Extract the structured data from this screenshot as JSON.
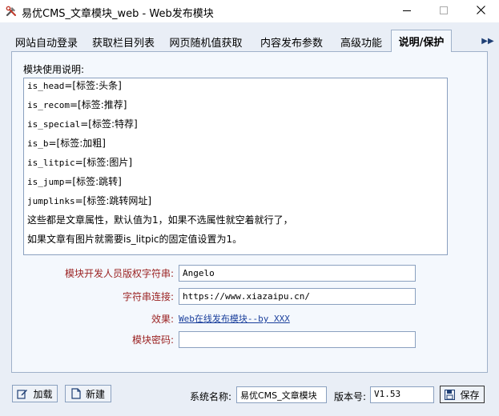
{
  "window": {
    "title": "易优CMS_文章模块_web - Web发布模块",
    "icon": "tools-icon"
  },
  "tabs": [
    {
      "label": "网站自动登录",
      "active": false
    },
    {
      "label": "获取栏目列表",
      "active": false
    },
    {
      "label": "网页随机值获取",
      "active": false
    },
    {
      "label": "内容发布参数",
      "active": false
    },
    {
      "label": "高级功能",
      "active": false
    },
    {
      "label": "说明/保护",
      "active": true
    }
  ],
  "tab_scroll_glyph": "▶▶",
  "notes": {
    "label": "模块使用说明:",
    "lines": [
      {
        "code": "is_head",
        "text": "=[标签:头条]"
      },
      {
        "code": "is_recom",
        "text": "=[标签:推荐]"
      },
      {
        "code": "is_special",
        "text": "=[标签:特荐]"
      },
      {
        "code": "is_b",
        "text": "=[标签:加粗]"
      },
      {
        "code": "is_litpic",
        "text": "=[标签:图片]"
      },
      {
        "code": "is_jump",
        "text": "=[标签:跳转]"
      },
      {
        "code": "jumplinks",
        "text": "=[标签:跳转网址]"
      },
      {
        "code": "",
        "text": "这些都是文章属性，默认值为1，如果不选属性就空着就行了，"
      },
      {
        "code": "",
        "text": "如果文章有图片就需要is_litpic的固定值设置为1。"
      }
    ]
  },
  "fields": {
    "copyright": {
      "label": "模块开发人员版权字符串:",
      "value": "Angelo"
    },
    "link": {
      "label": "字符串连接:",
      "value": "https://www.xiazaipu.cn/"
    },
    "effect": {
      "label": "效果:",
      "value": "Web在线发布模块--by XXX"
    },
    "password": {
      "label": "模块密码:",
      "value": ""
    }
  },
  "bottom": {
    "load_label": "加载",
    "new_label": "新建",
    "system_label": "系统名称:",
    "system_value": "易优CMS_文章模块",
    "version_label": "版本号:",
    "version_value": "V1.53",
    "save_label": "保存"
  },
  "colors": {
    "accent_label": "#9b2323",
    "link": "#1a3f9c",
    "background": "#e9eef6"
  }
}
